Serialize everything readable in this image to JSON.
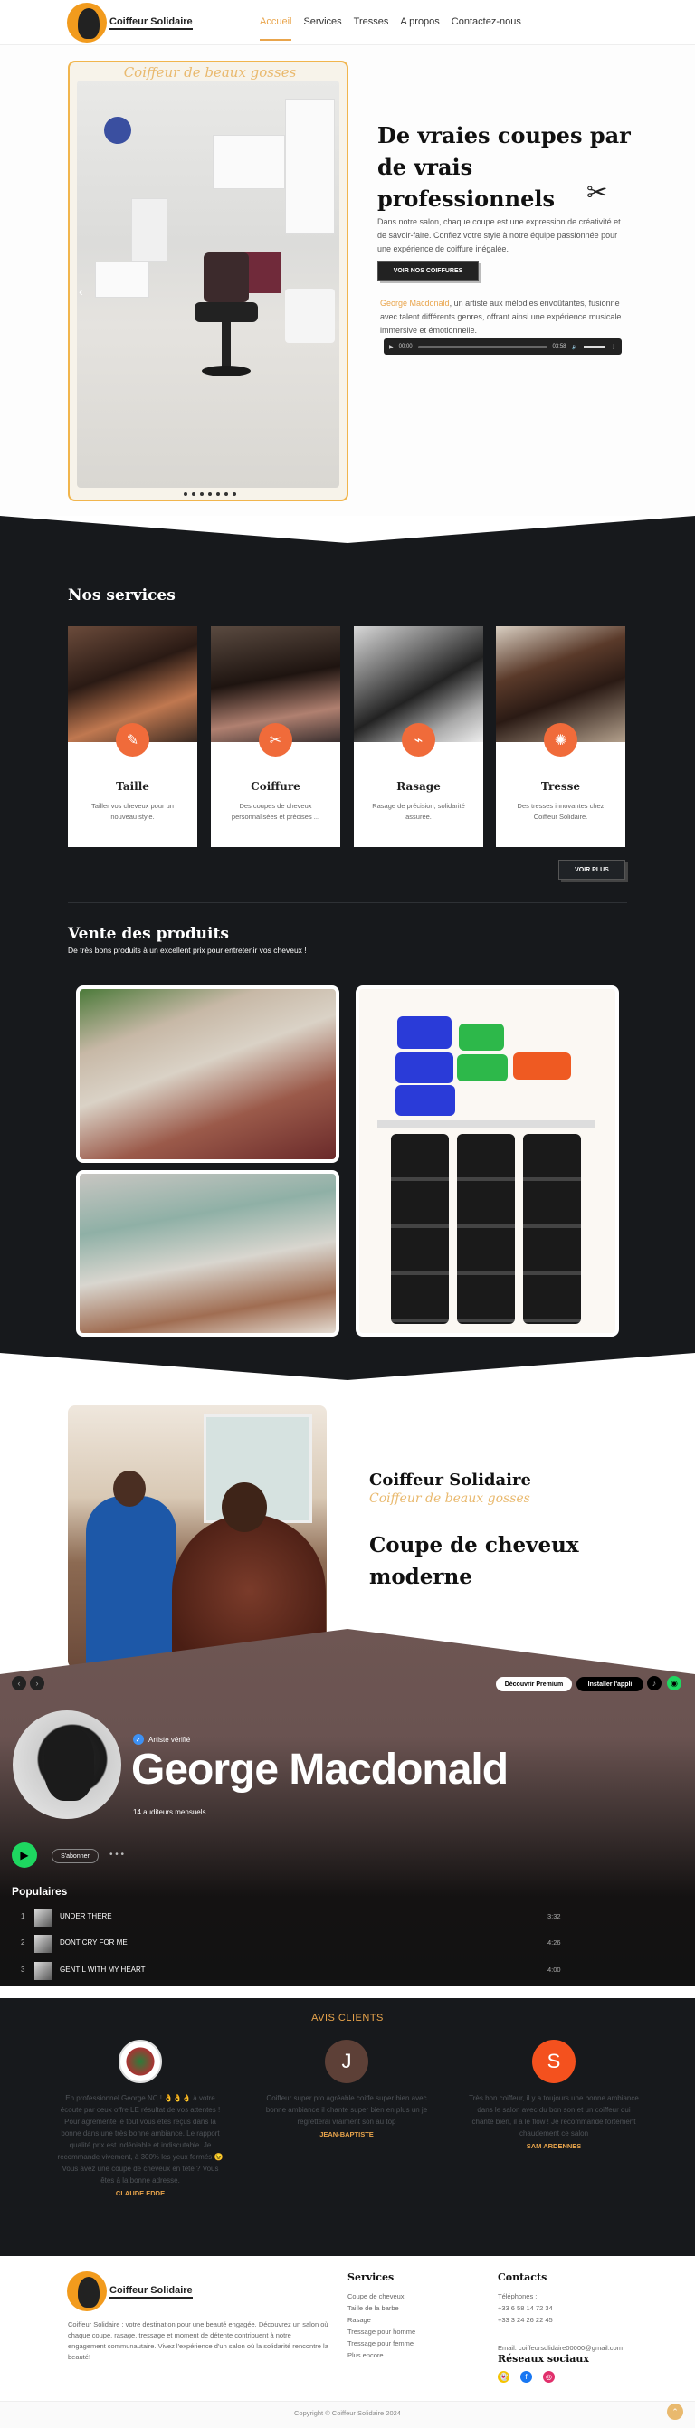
{
  "brand": {
    "name": "Coiffeur Solidaire",
    "logo_icon": "afro-silhouette-logo"
  },
  "nav": {
    "items": [
      "Accueil",
      "Services",
      "Tresses",
      "A propos",
      "Contactez-nous"
    ],
    "active": "Accueil"
  },
  "hero": {
    "carousel_caption": "Coiffeur de beaux gosses",
    "title": "De vraies coupes par de vrais professionnels",
    "text": "Dans notre salon, chaque coupe est une expression de créativité et de savoir-faire. Confiez votre style à notre équipe passionnée pour une expérience de coiffure inégalée.",
    "button": "VOIR NOS COIFFURES",
    "artist_name": "George Macdonald",
    "artist_text": ", un artiste aux mélodies envoûtantes, fusionne avec talent différents genres, offrant ainsi une expérience musicale immersive et émotionnelle.",
    "audio": {
      "current": "00:00",
      "duration": "03:58"
    }
  },
  "services": {
    "title": "Nos services",
    "cards": [
      {
        "title": "Taille",
        "desc": "Tailler vos cheveux pour un nouveau style.",
        "icon": "razor-icon"
      },
      {
        "title": "Coiffure",
        "desc": "Des coupes de cheveux personnalisées et précises ...",
        "icon": "scissors-icon"
      },
      {
        "title": "Rasage",
        "desc": "Rasage de précision, solidarité assurée.",
        "icon": "shaver-icon"
      },
      {
        "title": "Tresse",
        "desc": "Des tresses innovantes chez Coiffeur Solidaire.",
        "icon": "sun-braid-icon"
      }
    ],
    "button": "VOIR PLUS"
  },
  "products": {
    "title": "Vente des produits",
    "subtitle": "De très bons produits à un excellent prix pour entretenir vos cheveux !"
  },
  "about": {
    "brand": "Coiffeur Solidaire",
    "tagline": "Coiffeur de beaux gosses",
    "title": "Coupe de cheveux moderne"
  },
  "spotify": {
    "premium_button": "Découvrir Premium",
    "install_button": "Installer l'appli",
    "verified": "Artiste vérifié",
    "artist": "George Macdonald",
    "listeners": "14 auditeurs mensuels",
    "follow": "S'abonner",
    "populaires": "Populaires",
    "tracks": [
      {
        "num": "1",
        "title": "UNDER THERE",
        "duration": "3:32"
      },
      {
        "num": "2",
        "title": "DONT CRY FOR ME",
        "duration": "4:26"
      },
      {
        "num": "3",
        "title": "GENTIL WITH MY HEART",
        "duration": "4:00"
      }
    ]
  },
  "reviews": {
    "title": "AVIS CLIENTS",
    "items": [
      {
        "initial": "",
        "text": "En professionnel George NC ! 👌👌👌 à votre écoute par ceux offre LE résultat de vos attentes ! Pour agrémenté le tout vous êtes reçus dans la bonne dans une très bonne ambiance. Le rapport qualité prix est indéniable et indiscutable. Je recommande vivement, à 300% les yeux fermés 😉 Vous avez une coupe de cheveux en tête ? Vous êtes à la bonne adresse.",
        "author": "CLAUDE EDDE",
        "color": "#ffffff"
      },
      {
        "initial": "J",
        "text": "Coiffeur super pro agréable coiffe super bien avec bonne ambiance il chante super bien en plus un je regretterai vraiment son au top",
        "author": "JEAN-BAPTISTE",
        "color": "#6d4c41"
      },
      {
        "initial": "S",
        "text": "Très bon coiffeur, il y a toujours une bonne ambiance dans le salon avec du bon son et un coiffeur qui chante bien, il a le flow ! Je recommande fortement chaudement ce salon",
        "author": "SAM ARDENNES",
        "color": "#f4511e"
      }
    ]
  },
  "footer": {
    "description": "Coiffeur Solidaire : votre destination pour une beauté engagée. Découvrez un salon où chaque coupe, rasage, tressage et moment de détente contribuent à notre engagement communautaire. Vivez l'expérience d'un salon où la solidarité rencontre la beauté!",
    "services_title": "Services",
    "services": [
      "Coupe de cheveux",
      "Taille de la barbe",
      "Rasage",
      "Tressage pour homme",
      "Tressage pour femme",
      "Plus encore"
    ],
    "contact_title": "Contacts",
    "phone_label": "Téléphones :",
    "phones": [
      "+33 6 58 14 72 34",
      "+33 3 24 26 22 45"
    ],
    "email": "Email: coiffeursolidaire00000@gmail.com",
    "socials_title": "Réseaux sociaux",
    "socials": [
      {
        "icon": "snapchat-icon",
        "color": "#f5c400"
      },
      {
        "icon": "facebook-icon",
        "color": "#1877f2"
      },
      {
        "icon": "instagram-icon",
        "color": "#e1306c"
      }
    ],
    "copyright": "Copyright © Coiffeur Solidaire 2024"
  }
}
